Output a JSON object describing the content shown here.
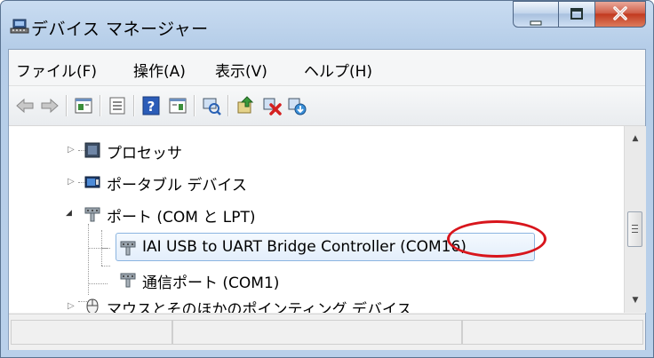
{
  "window": {
    "title": "デバイス マネージャー",
    "title_icon": "device-manager-icon"
  },
  "controls": {
    "minimize_glyph": "—",
    "maximize_glyph": "□",
    "close_glyph": "X"
  },
  "menu": {
    "items": [
      {
        "label": "ファイル(F)"
      },
      {
        "label": "操作(A)"
      },
      {
        "label": "表示(V)"
      },
      {
        "label": "ヘルプ(H)"
      }
    ]
  },
  "toolbar": {
    "buttons": [
      "back-arrow-icon",
      "forward-arrow-icon",
      "properties-icon",
      "show-hidden-icon",
      "help-icon",
      "action-pane-icon",
      "scan-hardware-icon",
      "update-driver-icon",
      "disable-device-icon",
      "uninstall-device-icon"
    ]
  },
  "tree": {
    "items": [
      {
        "label": "プロセッサ",
        "icon": "processor-icon",
        "expander": "▷"
      },
      {
        "label": "ポータブル デバイス",
        "icon": "portable-device-icon",
        "expander": "▷"
      },
      {
        "label": "ポート (COM と LPT)",
        "icon": "port-icon",
        "expander": "◢"
      },
      {
        "label": "IAI USB to UART Bridge Controller (COM16)",
        "icon": "port-icon"
      },
      {
        "label": "通信ポート (COM1)",
        "icon": "port-icon"
      },
      {
        "label": "マウスとそのほかのポインティング デバイス",
        "icon": "mouse-icon",
        "expander": "▷"
      }
    ]
  },
  "scrollbar": {
    "up_glyph": "▲",
    "down_glyph": "▼"
  },
  "colors": {
    "highlight_circle": "#d8151c",
    "selection_border": "#8cb5e0"
  }
}
